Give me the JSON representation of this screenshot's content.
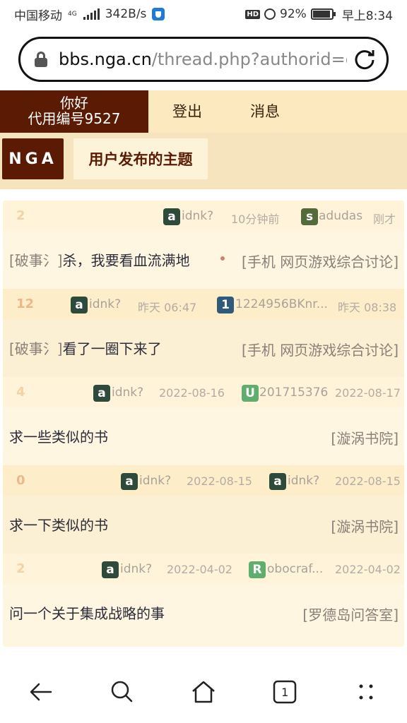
{
  "status": {
    "carrier": "中国移动",
    "net_badge": "4G",
    "speed": "342B/s",
    "battery": "92%",
    "battery_level": 0.92,
    "time": "早上8:34",
    "hd": "HD"
  },
  "browser": {
    "url_host": "bbs.nga.cn",
    "url_path": "/thread.php?authorid=c"
  },
  "header": {
    "greeting": "你好",
    "user": "代用编号9527",
    "login": "登出",
    "messages": "消息",
    "logo": "NGA",
    "page_title": "用户发布的主题"
  },
  "threads": [
    {
      "replies": "2",
      "author_initial": "a",
      "author_color": "#2e4a3a",
      "author": "idnk?",
      "post_time": "10分钟前",
      "last_initial": "s",
      "last_color": "#556a3a",
      "last_user": "adudas",
      "last_time": "刚才",
      "tag": "[破事氵]",
      "title": "杀，我要看血流满地",
      "forum": "[手机 网页游戏综合讨论]"
    },
    {
      "replies": "12",
      "author_initial": "a",
      "author_color": "#2e4a3a",
      "author": "idnk?",
      "post_time": "昨天 06:47",
      "last_initial": "1",
      "last_color": "#2f5a7a",
      "last_user": "1224956BKnr...",
      "last_time": "昨天 08:38",
      "tag": "[破事氵]",
      "title": "看了一圈下来了",
      "forum": "[手机 网页游戏综合讨论]"
    },
    {
      "replies": "4",
      "author_initial": "a",
      "author_color": "#2e4a3a",
      "author": "idnk?",
      "post_time": "2022-08-16",
      "last_initial": "U",
      "last_color": "#5fae6e",
      "last_user": "201715376",
      "last_time": "2022-08-17",
      "tag": "",
      "title": "求一些类似的书",
      "forum": "[漩涡书院]"
    },
    {
      "replies": "0",
      "author_initial": "a",
      "author_color": "#2e4a3a",
      "author": "idnk?",
      "post_time": "2022-08-15",
      "last_initial": "a",
      "last_color": "#2e4a3a",
      "last_user": "idnk?",
      "last_time": "2022-08-15",
      "tag": "",
      "title": "求一下类似的书",
      "forum": "[漩涡书院]"
    },
    {
      "replies": "2",
      "author_initial": "a",
      "author_color": "#2e4a3a",
      "author": "idnk?",
      "post_time": "2022-04-02",
      "last_initial": "R",
      "last_color": "#5fae6e",
      "last_user": "obocraf...",
      "last_time": "2022-04-02",
      "tag": "",
      "title": "问一个关于集成战略的事",
      "forum": "[罗德岛问答室]"
    }
  ],
  "bottom_nav": {
    "tab_count": "1",
    "icons": [
      "back-arrow-icon",
      "search-icon",
      "home-icon",
      "tabs-icon",
      "more-icon"
    ]
  }
}
